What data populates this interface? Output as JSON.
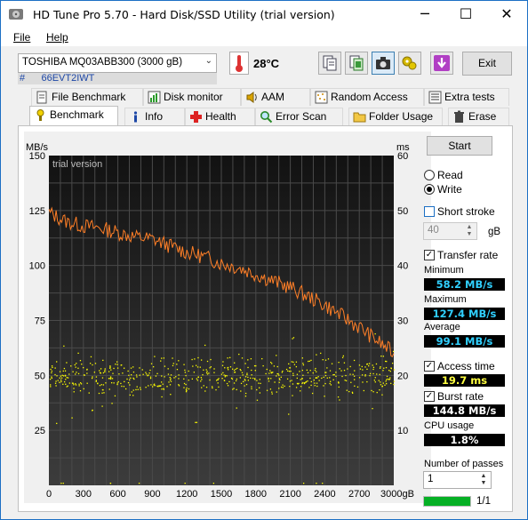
{
  "window": {
    "title": "HD Tune Pro 5.70 - Hard Disk/SSD Utility (trial version)",
    "minimize": "─",
    "maximize": "☐",
    "close": "✕"
  },
  "menu": {
    "file": "File",
    "help": "Help"
  },
  "drive": {
    "name": "TOSHIBA MQ03ABB300 (3000 gB)",
    "info": "#      66EVT2IWT"
  },
  "temperature": "28°C",
  "toolbar": {
    "buttons": [
      "copy-info-icon",
      "copy-green-icon",
      "camera-icon",
      "options-icon",
      "save-icon"
    ],
    "exit_label": "Exit"
  },
  "tabs_row1": [
    "File Benchmark",
    "Disk monitor",
    "AAM",
    "Random Access",
    "Extra tests"
  ],
  "tabs_row2": [
    "Benchmark",
    "Info",
    "Health",
    "Error Scan",
    "Folder Usage",
    "Erase"
  ],
  "controls": {
    "start_label": "Start",
    "read_label": "Read",
    "write_label": "Write",
    "mode_selected": "write",
    "short_stroke_label": "Short stroke",
    "short_stroke_checked": false,
    "short_stroke_value": "40",
    "short_stroke_unit": "gB",
    "transfer_rate_label": "Transfer rate",
    "transfer_rate_checked": true,
    "access_time_label": "Access time",
    "access_time_checked": true,
    "burst_rate_label": "Burst rate",
    "burst_rate_checked": true,
    "passes_label": "Number of passes",
    "passes_value": "1",
    "pass_progress": "1/1",
    "pass_fraction": 1.0
  },
  "stats": {
    "minimum_label": "Minimum",
    "minimum_value": "58.2 MB/s",
    "maximum_label": "Maximum",
    "maximum_value": "127.4 MB/s",
    "average_label": "Average",
    "average_value": "99.1 MB/s",
    "access_time_value": "19.7 ms",
    "burst_rate_value": "144.8 MB/s",
    "cpu_usage_label": "CPU usage",
    "cpu_usage_value": "1.8%",
    "colors": {
      "transfer": "#30d0ff",
      "access": "#ffff40",
      "burst": "#ffffff",
      "cpu": "#ffffff"
    }
  },
  "chart_data": {
    "type": "line",
    "watermark": "trial version",
    "y_left_label": "MB/s",
    "y_right_label": "ms",
    "y_left_ticks": [
      "150",
      "125",
      "100",
      "75",
      "50",
      "25"
    ],
    "y_right_ticks": [
      "60",
      "50",
      "40",
      "30",
      "20",
      "10"
    ],
    "x_ticks": [
      "0",
      "300",
      "600",
      "900",
      "1200",
      "1500",
      "1800",
      "2100",
      "2400",
      "2700",
      "3000gB"
    ],
    "ylim_left": [
      0,
      150
    ],
    "ylim_right": [
      0,
      60
    ],
    "xlim": [
      0,
      3000
    ],
    "grid": true,
    "series": [
      {
        "name": "Transfer rate",
        "color": "#ff7f27",
        "x": [
          0,
          150,
          300,
          450,
          600,
          750,
          900,
          1050,
          1200,
          1350,
          1500,
          1650,
          1800,
          1950,
          2100,
          2250,
          2400,
          2550,
          2700,
          2850,
          3000
        ],
        "y": [
          124,
          120,
          118,
          117,
          115,
          113,
          112,
          109,
          106,
          104,
          101,
          99,
          96,
          93,
          90,
          86,
          82,
          77,
          72,
          66,
          60
        ]
      },
      {
        "name": "Access time",
        "color": "#ffff00",
        "type": "scatter",
        "y_center_ms": 20,
        "y_spread_ms": 4
      }
    ]
  }
}
